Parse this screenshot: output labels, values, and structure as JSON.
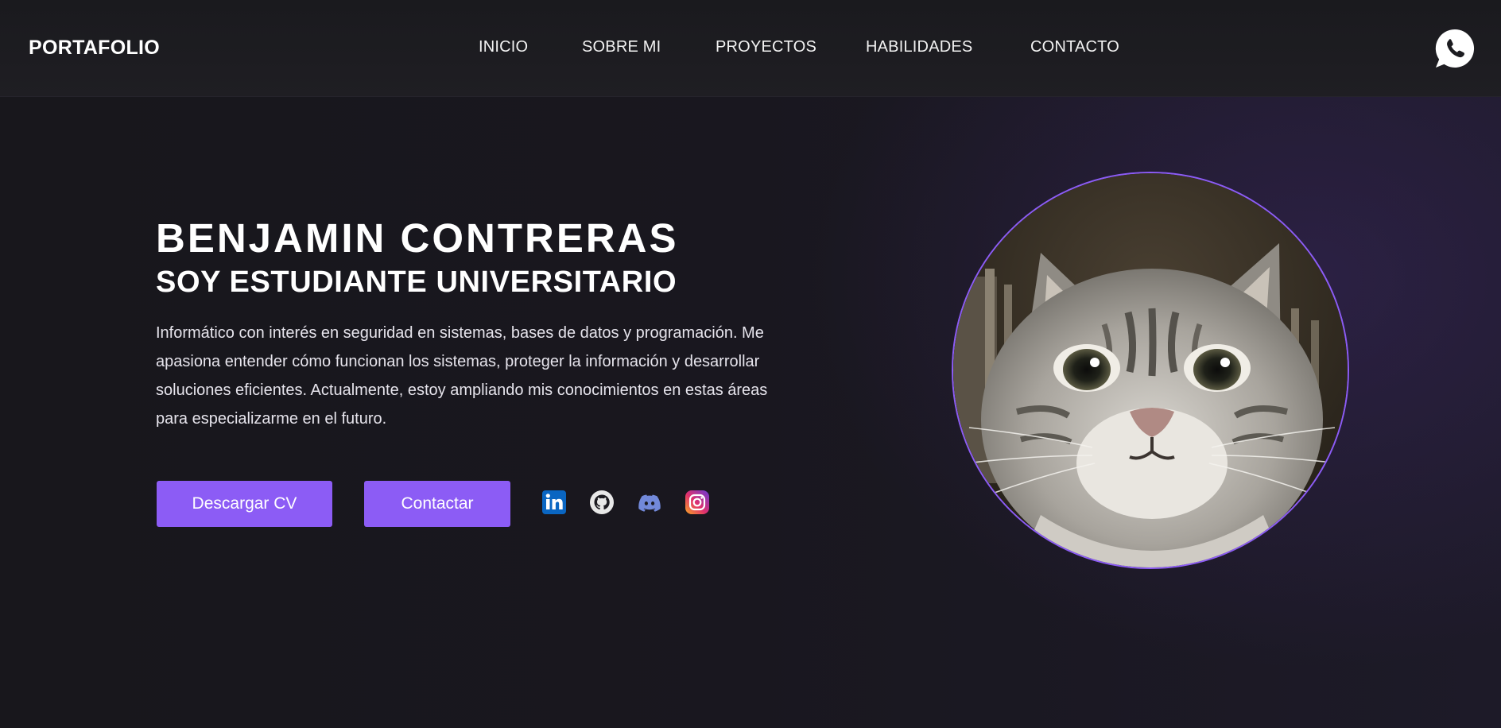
{
  "header": {
    "brand": "PORTAFOLIO",
    "nav": [
      "INICIO",
      "SOBRE MI",
      "PROYECTOS",
      "HABILIDADES",
      "CONTACTO"
    ],
    "whatsapp_icon": "whatsapp-icon"
  },
  "hero": {
    "name": "BENJAMIN CONTRERAS",
    "subtitle": "SOY ESTUDIANTE UNIVERSITARIO",
    "description": "Informático con interés en seguridad en sistemas, bases de datos y programación. Me apasiona entender cómo funcionan los sistemas, proteger la información y desarrollar soluciones eficientes. Actualmente, estoy ampliando mis conocimientos en estas áreas para especializarme en el futuro.",
    "buttons": {
      "download_cv": "Descargar CV",
      "contact": "Contactar"
    },
    "social_icons": [
      "linkedin-icon",
      "github-icon",
      "discord-icon",
      "instagram-icon"
    ]
  },
  "colors": {
    "accent": "#8c5cf5",
    "background": "#17161c",
    "header": "#1e1d22",
    "linkedin": "#0a66c2",
    "discord": "#7289da"
  }
}
